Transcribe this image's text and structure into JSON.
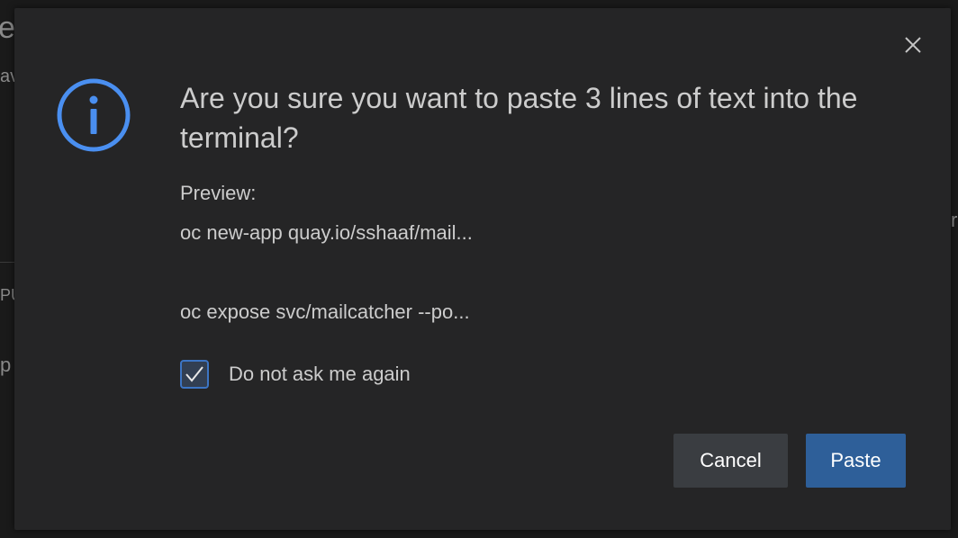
{
  "background": {
    "fragments": [
      "e",
      "av",
      "PU",
      "p",
      "r"
    ]
  },
  "dialog": {
    "icon": "info-icon",
    "title": "Are you sure you want to paste 3 lines of text into the terminal?",
    "preview_label": "Preview:",
    "preview_lines": [
      "oc new-app quay.io/sshaaf/mail...",
      "",
      "oc expose svc/mailcatcher --po..."
    ],
    "checkbox": {
      "label": "Do not ask me again",
      "checked": true
    },
    "buttons": {
      "cancel": "Cancel",
      "paste": "Paste"
    }
  },
  "colors": {
    "dialog_bg": "#252526",
    "text": "#cccccc",
    "accent": "#4a8ff0",
    "primary_button": "#2e5f99",
    "secondary_button": "#3a3d41"
  }
}
